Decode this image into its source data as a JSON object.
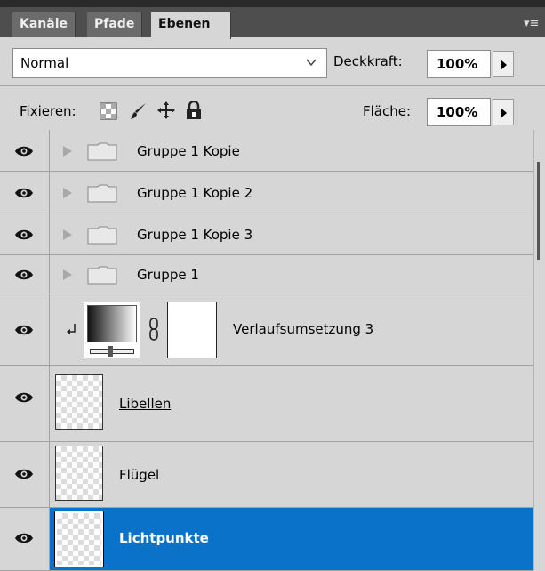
{
  "tabs": [
    {
      "label": "Kanäle",
      "active": false
    },
    {
      "label": "Pfade",
      "active": false
    },
    {
      "label": "Ebenen",
      "active": true
    }
  ],
  "options": {
    "blend_mode": "Normal",
    "opacity_label": "Deckkraft:",
    "opacity_value": "100%",
    "lock_label": "Fixieren:",
    "fill_label": "Fläche:",
    "fill_value": "100%"
  },
  "layers": [
    {
      "name": "Gruppe 1 Kopie",
      "type": "group",
      "visible": true
    },
    {
      "name": "Gruppe 1 Kopie 2",
      "type": "group",
      "visible": true
    },
    {
      "name": "Gruppe 1 Kopie 3",
      "type": "group",
      "visible": true
    },
    {
      "name": "Gruppe 1",
      "type": "group",
      "visible": true
    },
    {
      "name": "Verlaufsumsetzung 3",
      "type": "adjustment",
      "visible": true
    },
    {
      "name": "Libellen",
      "type": "pixel",
      "visible": true
    },
    {
      "name": "Flügel",
      "type": "pixel",
      "visible": true
    },
    {
      "name": "Lichtpunkte",
      "type": "pixel",
      "visible": true,
      "selected": true
    }
  ],
  "colors": {
    "selection": "#0a72c8",
    "panel_bg": "#d6d6d6",
    "tabbar_bg": "#4e4e4e"
  }
}
